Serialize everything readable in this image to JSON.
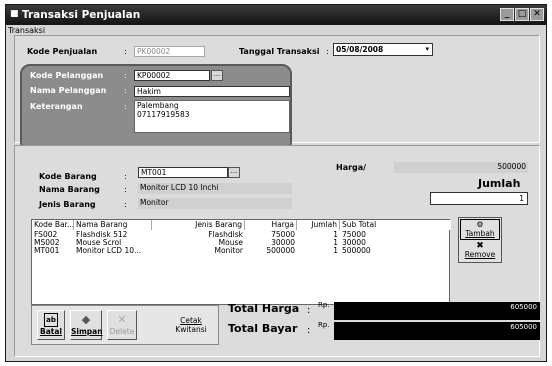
{
  "window": {
    "title": "Transaksi Penjualan",
    "menu_label": "Transaksi",
    "controls": {
      "minimize": "_",
      "maximize": "□",
      "close": "✕"
    }
  },
  "header": {
    "kode_penjualan_label": "Kode Penjualan",
    "kode_penjualan_value": "PK00002",
    "tanggal_label": "Tanggal Transaksi",
    "tanggal_value": "05/08/2008"
  },
  "pelanggan": {
    "kode_label": "Kode Pelanggan",
    "kode_value": "KP00002",
    "nama_label": "Nama Pelanggan",
    "nama_value": "Hakim",
    "keterangan_label": "Keterangan",
    "keterangan_line1": "Palembang",
    "keterangan_line2": "07117919583"
  },
  "barang": {
    "kode_label": "Kode Barang",
    "kode_value": "MT001",
    "nama_label": "Nama Barang",
    "nama_value": "Monitor LCD 10 Inchi",
    "jenis_label": "Jenis Barang",
    "jenis_value": "Monitor",
    "harga_label": "Harga/",
    "harga_value": "500000",
    "jumlah_label": "Jumlah",
    "jumlah_value": "1"
  },
  "colon": ":",
  "table": {
    "columns": [
      "Kode Bar...",
      "Nama Barang",
      "Jenis Barang",
      "Harga",
      "Jumlah",
      "Sub Total"
    ],
    "rows": [
      [
        "FS002",
        "Flashdisk 512",
        "Flashdisk",
        "75000",
        "1",
        "75000"
      ],
      [
        "MS002",
        "Mouse Scrol",
        "Mouse",
        "30000",
        "1",
        "30000"
      ],
      [
        "MT001",
        "Monitor LCD 10...",
        "Monitor",
        "500000",
        "1",
        "500000"
      ]
    ]
  },
  "side_buttons": {
    "tambah": "Tambah",
    "remove": "Remove"
  },
  "bottom_buttons": {
    "batal": "Batal",
    "simpan": "Simpan",
    "delete": "Delete",
    "cetak_line1": "Cetak",
    "cetak_line2": "Kwitansi"
  },
  "totals": {
    "total_harga_label": "Total Harga",
    "total_bayar_label": "Total Bayar",
    "currency": "Rp.",
    "total_harga_value": "605000",
    "total_bayar_value": "605000"
  }
}
